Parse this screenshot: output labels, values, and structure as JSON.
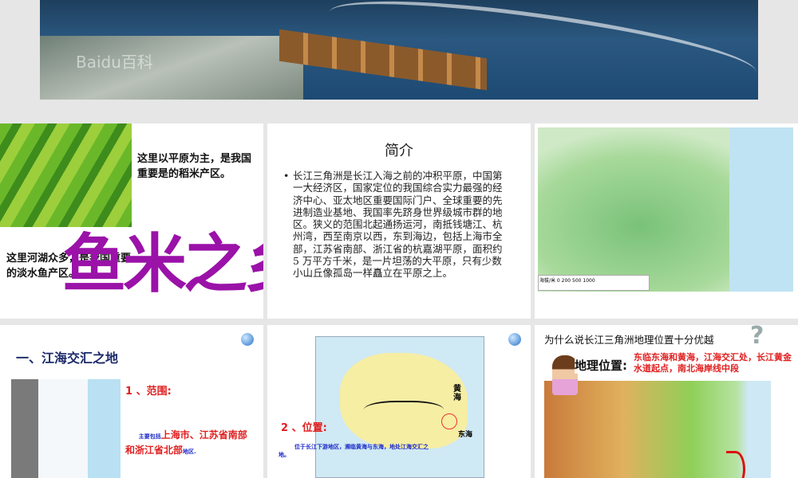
{
  "slide_top": {
    "watermark": "Baidu百科"
  },
  "slide_rice": {
    "text_plain": "这里以平原为主，是我国重要是的稻米产区。",
    "text_lake": "这里河湖众多，是我国重要的淡水鱼产区。",
    "wordart": "鱼米之乡"
  },
  "slide_intro": {
    "title": "简介",
    "body": "长江三角洲是长江入海之前的冲积平原，中国第一大经济区，国家定位的我国综合实力最强的经济中心、亚太地区重要国际门户、全球重要的先进制造业基地、我国率先跻身世界级城市群的地区。狭义的范围北起通扬运河，南抵钱塘江、杭州湾，西至南京以西，东到海边，包括上海市全部，江苏省南部、浙江省的杭嘉湖平原，面积约 5 万平方千米，是一片坦荡的大平原，只有少数小山丘像孤岛一样矗立在平原之上。"
  },
  "slide_map": {
    "legend": "海拔/米  0 200 500 1000"
  },
  "slide_scope": {
    "heading": "一、江海交汇之地",
    "label": "1 、范围:",
    "pre": "主要包括",
    "highlight": "上海市、江苏省南部和浙江省北部",
    "post": "地区."
  },
  "slide_position": {
    "label": "2 、位置:",
    "text": "位于长江下游地区，濒临黄海与东海，地处江海交汇之地。",
    "yellow_sea": "黄海",
    "east_sea": "东海"
  },
  "slide_why": {
    "question": "为什么说长江三角洲地理位置十分优越",
    "q_mark": "?",
    "geo_label": "地理位置:",
    "geo_text": "东临东海和黄海，江海交汇处，长江黄金水道起点，南北海岸线中段"
  }
}
